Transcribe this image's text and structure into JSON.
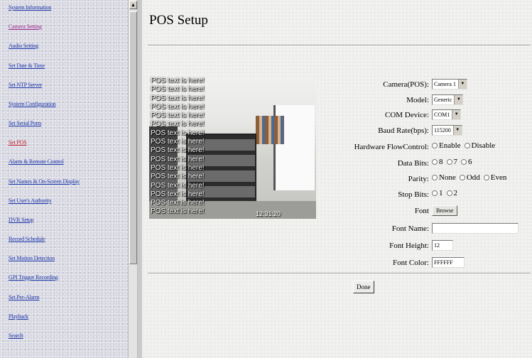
{
  "nav": {
    "items": [
      {
        "label": "System Information",
        "state": "normal"
      },
      {
        "label": "Camera Setting",
        "state": "visited"
      },
      {
        "label": "Audio Setting",
        "state": "normal"
      },
      {
        "label": "Set Date & Time",
        "state": "normal"
      },
      {
        "label": "Set NTP Server",
        "state": "normal"
      },
      {
        "label": "System Configuration",
        "state": "normal"
      },
      {
        "label": "Set Serial Ports",
        "state": "normal"
      },
      {
        "label": "Set POS",
        "state": "active"
      },
      {
        "label": "Alarm & Remote Control",
        "state": "normal"
      },
      {
        "label": "Set Names & On-Screen Display",
        "state": "normal"
      },
      {
        "label": "Set User's Authority",
        "state": "normal"
      },
      {
        "label": "DVR Setup",
        "state": "normal"
      },
      {
        "label": "Record Schedule",
        "state": "normal"
      },
      {
        "label": "Set Motion Detection",
        "state": "normal"
      },
      {
        "label": "GPI Trigger Recording",
        "state": "normal"
      },
      {
        "label": "Set Pre-Alarm",
        "state": "normal"
      },
      {
        "label": "Playback",
        "state": "normal"
      },
      {
        "label": "Search",
        "state": "normal"
      }
    ],
    "colors": {
      "link": "#1a34a8",
      "visited": "#9a2a8c",
      "active": "#c0212e"
    }
  },
  "page": {
    "title": "POS Setup"
  },
  "preview": {
    "pos_lines": [
      "POS text is here!",
      "POS text is here!",
      "POS text is here!",
      "POS text is here!",
      "POS text is here!",
      "POS text is here!",
      "POS text is here!",
      "POS text is here!",
      "POS text is here!",
      "POS text is here!",
      "POS text is here!",
      "POS text is here!",
      "POS text is here!",
      "POS text is here!",
      "POS text is here!",
      "POS text is here!"
    ],
    "timestamp": "12:31:20"
  },
  "form": {
    "camera": {
      "label": "Camera(POS):",
      "value": "Camera 1"
    },
    "model": {
      "label": "Model:",
      "value": "Generic"
    },
    "com_device": {
      "label": "COM Device:",
      "value": "COM1"
    },
    "baud_rate": {
      "label": "Baud Rate(bps):",
      "value": "115200"
    },
    "flow_control": {
      "label": "Hardware FlowControl:",
      "options": [
        "Enable",
        "Disable"
      ]
    },
    "data_bits": {
      "label": "Data Bits:",
      "options": [
        "8",
        "7",
        "6"
      ]
    },
    "parity": {
      "label": "Parity:",
      "options": [
        "None",
        "Odd",
        "Even"
      ]
    },
    "stop_bits": {
      "label": "Stop Bits:",
      "options": [
        "1",
        "2"
      ]
    },
    "font": {
      "label": "Font",
      "button": "Browse"
    },
    "font_name": {
      "label": "Font Name:",
      "value": ""
    },
    "font_height": {
      "label": "Font Height:",
      "value": "12"
    },
    "font_color": {
      "label": "Font Color:",
      "value": "FFFFFF"
    }
  },
  "done_button": "Done"
}
